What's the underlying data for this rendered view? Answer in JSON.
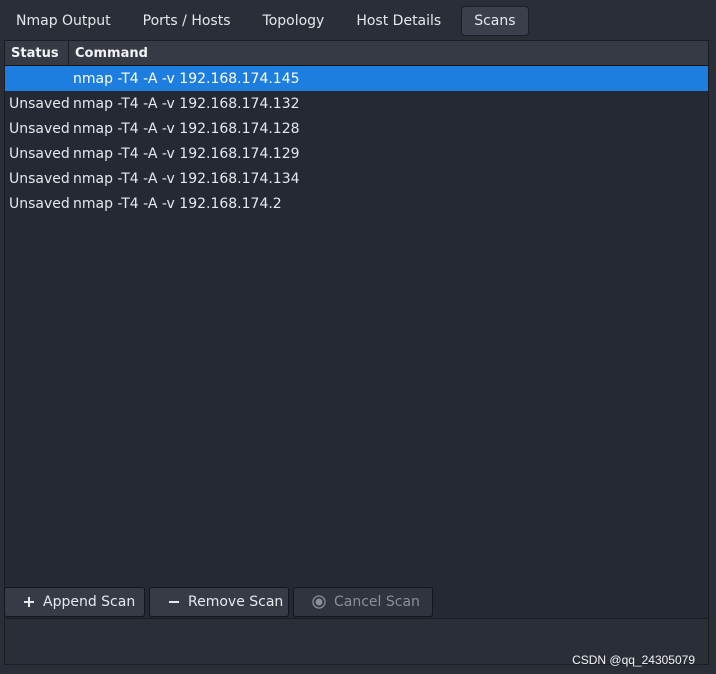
{
  "tabs": [
    {
      "label": "Nmap Output"
    },
    {
      "label": "Ports / Hosts"
    },
    {
      "label": "Topology"
    },
    {
      "label": "Host Details"
    },
    {
      "label": "Scans",
      "active": true
    }
  ],
  "table": {
    "columns": [
      "Status",
      "Command"
    ],
    "rows": [
      {
        "status": "",
        "command": "nmap -T4 -A -v 192.168.174.145",
        "selected": true
      },
      {
        "status": "Unsaved",
        "command": "nmap -T4 -A -v 192.168.174.132"
      },
      {
        "status": "Unsaved",
        "command": "nmap -T4 -A -v 192.168.174.128"
      },
      {
        "status": "Unsaved",
        "command": "nmap -T4 -A -v 192.168.174.129"
      },
      {
        "status": "Unsaved",
        "command": "nmap -T4 -A -v 192.168.174.134"
      },
      {
        "status": "Unsaved",
        "command": "nmap -T4 -A -v 192.168.174.2"
      }
    ]
  },
  "buttons": {
    "append": {
      "label": "Append Scan",
      "icon": "plus-icon"
    },
    "remove": {
      "label": "Remove Scan",
      "icon": "minus-icon"
    },
    "cancel": {
      "label": "Cancel Scan",
      "icon": "stop-icon",
      "disabled": true
    }
  },
  "watermark": "CSDN @qq_24305079",
  "colors": {
    "selection": "#1e7ee0",
    "background": "#2a2e37",
    "list_background": "#252933"
  }
}
